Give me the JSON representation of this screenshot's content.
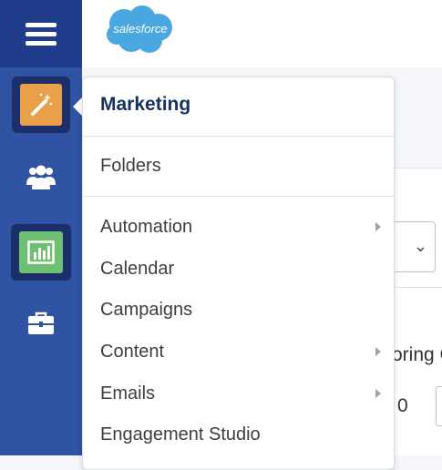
{
  "header": {
    "logo_text": "salesforce",
    "logo_color": "#4aa8e0"
  },
  "nav": {
    "items": [
      {
        "icon": "menu-icon"
      },
      {
        "icon": "magic-wand-icon",
        "selected": true
      },
      {
        "icon": "users-icon"
      },
      {
        "icon": "report-chart-icon"
      },
      {
        "icon": "briefcase-icon"
      }
    ],
    "colors": {
      "rail": "#3153a3",
      "rail_top": "#1f3d8a",
      "wand_tile": "#e8a04a",
      "report_tile": "#6fbf73"
    }
  },
  "flyout": {
    "title": "Marketing",
    "items": [
      {
        "label": "Folders",
        "has_submenu": false
      },
      {
        "label": "Automation",
        "has_submenu": true
      },
      {
        "label": "Calendar",
        "has_submenu": false
      },
      {
        "label": "Campaigns",
        "has_submenu": false
      },
      {
        "label": "Content",
        "has_submenu": true
      },
      {
        "label": "Emails",
        "has_submenu": true
      },
      {
        "label": "Engagement Studio",
        "has_submenu": false
      }
    ]
  },
  "background": {
    "partial_text_1": "oring C",
    "partial_text_2": "0"
  }
}
